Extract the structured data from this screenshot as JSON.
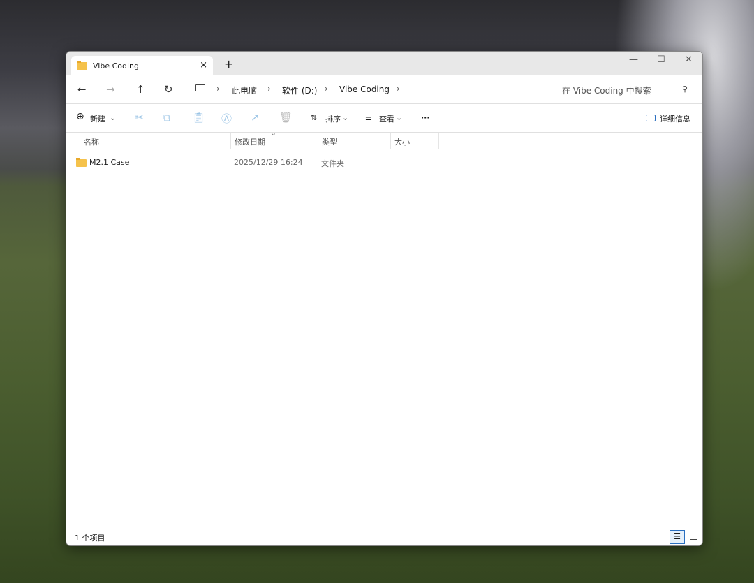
{
  "tab": {
    "title": "Vibe Coding",
    "close": "×",
    "new_tab": "+"
  },
  "window_controls": {
    "minimize": "—",
    "maximize": "☐",
    "close": "✕"
  },
  "nav": {
    "back": "←",
    "forward": "→",
    "up": "↑",
    "refresh": "↻"
  },
  "breadcrumb": [
    "此电脑",
    "软件 (D:)",
    "Vibe Coding"
  ],
  "breadcrumb_sep": "›",
  "search": {
    "placeholder": "在 Vibe Coding 中搜索",
    "icon": "⚲"
  },
  "toolbar": {
    "new": "新建",
    "sort": "排序",
    "view": "查看",
    "more": "···",
    "details": "详细信息",
    "chev": "⌄"
  },
  "columns": [
    "名称",
    "修改日期",
    "类型",
    "大小"
  ],
  "files": [
    {
      "name": "M2.1 Case",
      "modified": "2025/12/29 16:24",
      "type": "文件夹",
      "size": ""
    }
  ],
  "status": {
    "count": "1 个项目"
  }
}
